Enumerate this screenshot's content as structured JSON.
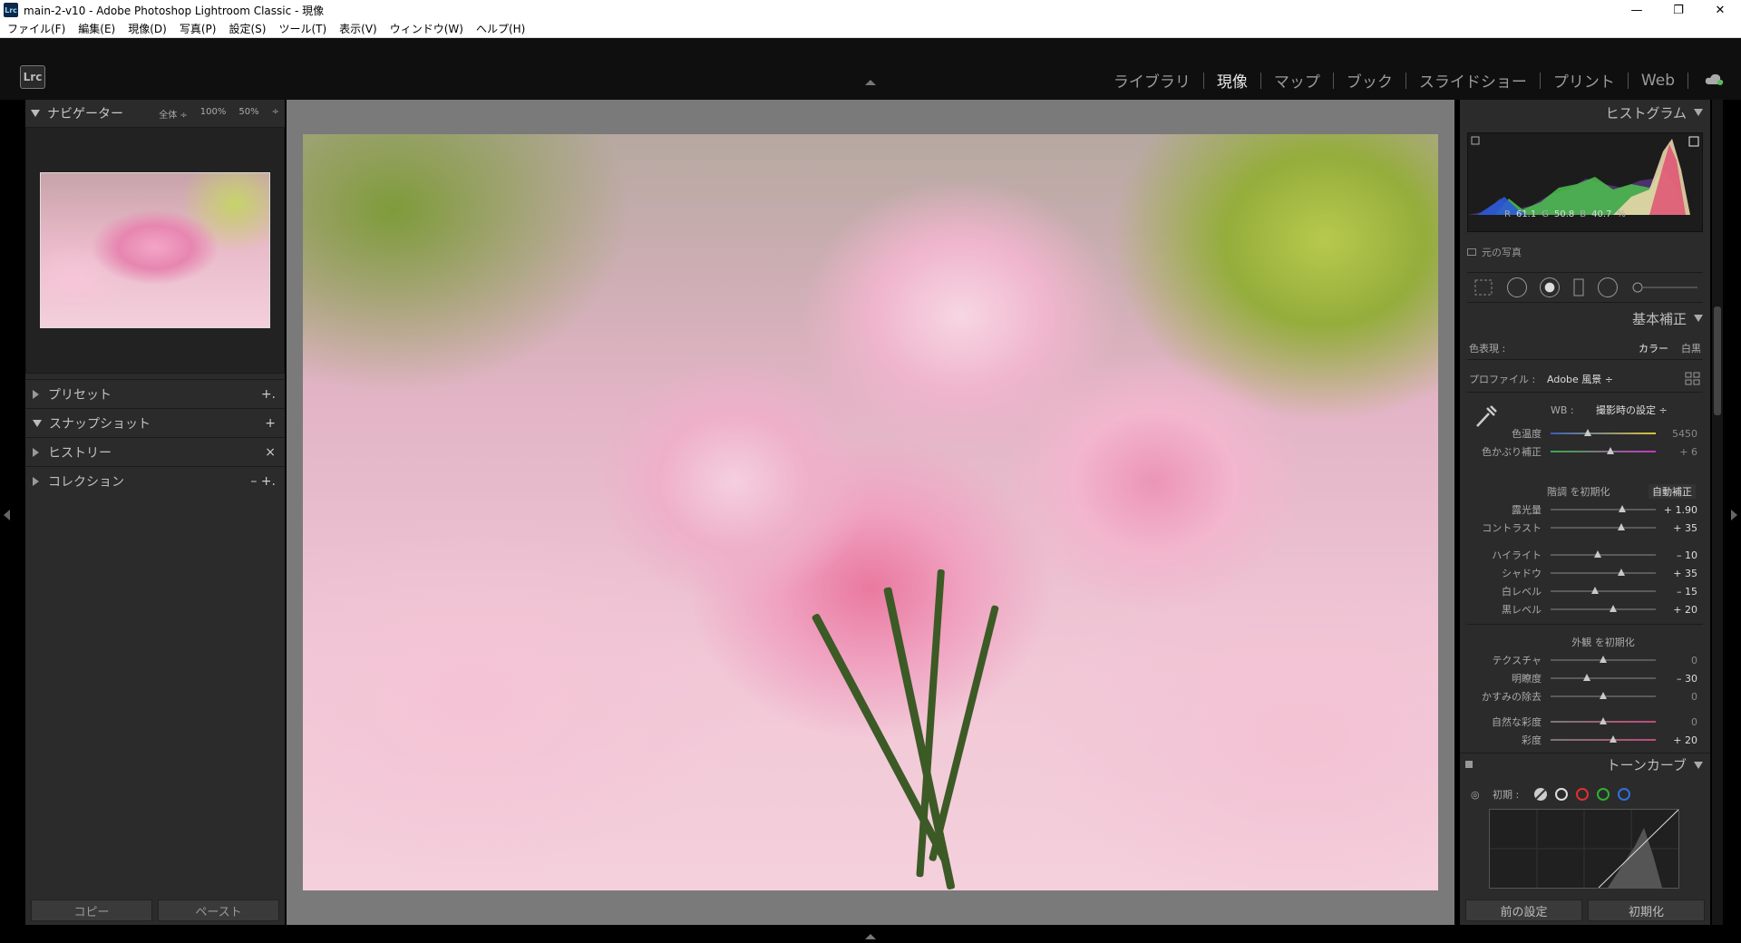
{
  "window": {
    "icon": "Lrc",
    "title": "main-2-v10 - Adobe Photoshop Lightroom Classic - 現像",
    "minimize": "—",
    "maximize": "❐",
    "close": "✕"
  },
  "menu": [
    "ファイル(F)",
    "編集(E)",
    "現像(D)",
    "写真(P)",
    "設定(S)",
    "ツール(T)",
    "表示(V)",
    "ウィンドウ(W)",
    "ヘルプ(H)"
  ],
  "header": {
    "logo": "Lrc",
    "modules": [
      "ライブラリ",
      "現像",
      "マップ",
      "ブック",
      "スライドショー",
      "プリント",
      "Web"
    ],
    "active_module": "現像"
  },
  "left": {
    "navigator": {
      "title": "ナビゲーター",
      "zoom_fit": "全体 ÷",
      "zoom_100": "100%",
      "zoom_50": "50%",
      "zoom_more": "÷"
    },
    "panels": [
      {
        "label": "プリセット",
        "action": "+."
      },
      {
        "label": "スナップショット",
        "action": "+"
      },
      {
        "label": "ヒストリー",
        "action": "×"
      },
      {
        "label": "コレクション",
        "action": "–  +."
      }
    ],
    "copy_label": "コピー",
    "paste_label": "ペースト"
  },
  "right": {
    "histogram": {
      "title": "ヒストグラム",
      "readout": {
        "r_label": "R",
        "r": "61.1",
        "g_label": "G",
        "g": "50.8",
        "b_label": "B",
        "b": "40.7",
        "unit": "%"
      },
      "original_photo": "元の写真"
    },
    "basic": {
      "title": "基本補正",
      "treatment_label": "色表現 :",
      "treatment_color": "カラー",
      "treatment_bw": "白黒",
      "profile_label": "プロファイル :",
      "profile_value": "Adobe 風景 ÷",
      "wb_label": "WB :",
      "wb_value": "撮影時の設定 ÷",
      "temp_label": "色温度",
      "temp_value": "5450",
      "tint_label": "色かぶり補正",
      "tint_value": "+ 6",
      "tone_reset": "階調 を初期化",
      "auto": "自動補正",
      "exposure_label": "露光量",
      "exposure_value": "+ 1.90",
      "contrast_label": "コントラスト",
      "contrast_value": "+ 35",
      "highlights_label": "ハイライト",
      "highlights_value": "– 10",
      "shadows_label": "シャドウ",
      "shadows_value": "+ 35",
      "whites_label": "白レベル",
      "whites_value": "– 15",
      "blacks_label": "黒レベル",
      "blacks_value": "+ 20",
      "presence_reset": "外観 を初期化",
      "texture_label": "テクスチャ",
      "texture_value": "0",
      "clarity_label": "明瞭度",
      "clarity_value": "– 30",
      "dehaze_label": "かすみの除去",
      "dehaze_value": "0",
      "vibrance_label": "自然な彩度",
      "vibrance_value": "0",
      "saturation_label": "彩度",
      "saturation_value": "+ 20"
    },
    "tonecurve": {
      "title": "トーンカーブ",
      "adjust_label": "初期 :"
    },
    "previous_label": "前の設定",
    "reset_label": "初期化"
  },
  "colors": {
    "panel_bg": "#2b2b2b",
    "canvas_bg": "#7a7a7a",
    "active_text": "#e8e8e8"
  }
}
